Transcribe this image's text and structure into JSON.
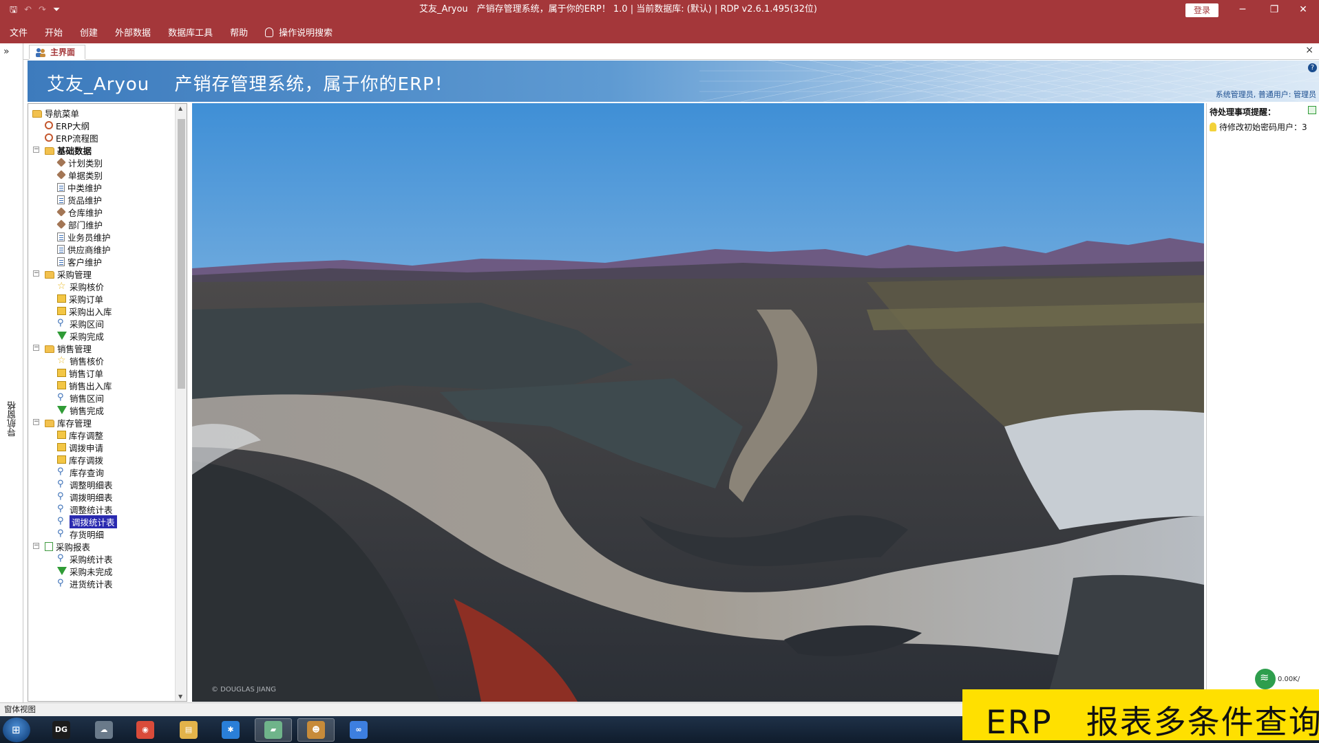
{
  "titlebar": {
    "title": "艾友_Aryou　产销存管理系统，属于你的ERP！ 1.0 | 当前数据库: (默认) | RDP v2.6.1.495(32位)",
    "login_label": "登录"
  },
  "menubar": {
    "items": [
      "文件",
      "开始",
      "创建",
      "外部数据",
      "数据库工具",
      "帮助"
    ],
    "search_label": "操作说明搜索"
  },
  "navpane": {
    "expand_glyph": "»",
    "vertical_label": "导航窗格"
  },
  "tabs": {
    "main_tab": "主界面",
    "close_glyph": "×"
  },
  "banner": {
    "brand": "艾友_Aryou",
    "title": "产销存管理系统，属于你的ERP！",
    "user_info": "系统管理员, 普通用户: 管理员",
    "help_glyph": "?"
  },
  "tree": {
    "nodes": [
      {
        "label": "导航菜单",
        "level": 0,
        "icon": "folder-open-icon",
        "toggle": ""
      },
      {
        "label": "ERP大纲",
        "level": 1,
        "icon": "gear-icon",
        "toggle": ""
      },
      {
        "label": "ERP流程图",
        "level": 1,
        "icon": "gear-icon",
        "toggle": ""
      },
      {
        "label": "基础数据",
        "level": 1,
        "icon": "folder-open-icon",
        "toggle": "−",
        "bold": true
      },
      {
        "label": "计划类别",
        "level": 2,
        "icon": "tag-icon"
      },
      {
        "label": "单据类别",
        "level": 2,
        "icon": "tag-icon"
      },
      {
        "label": "中类维护",
        "level": 2,
        "icon": "document-icon"
      },
      {
        "label": "货品维护",
        "level": 2,
        "icon": "document-icon"
      },
      {
        "label": "仓库维护",
        "level": 2,
        "icon": "tag-icon"
      },
      {
        "label": "部门维护",
        "level": 2,
        "icon": "tag-icon"
      },
      {
        "label": "业务员维护",
        "level": 2,
        "icon": "document-icon"
      },
      {
        "label": "供应商维护",
        "level": 2,
        "icon": "document-icon"
      },
      {
        "label": "客户维护",
        "level": 2,
        "icon": "document-icon"
      },
      {
        "label": "采购管理",
        "level": 1,
        "icon": "folder-open-icon",
        "toggle": "−"
      },
      {
        "label": "采购核价",
        "level": 2,
        "icon": "star-icon"
      },
      {
        "label": "采购订单",
        "level": 2,
        "icon": "box-icon"
      },
      {
        "label": "采购出入库",
        "level": 2,
        "icon": "box-icon"
      },
      {
        "label": "采购区间",
        "level": 2,
        "icon": "key-icon"
      },
      {
        "label": "采购完成",
        "level": 2,
        "icon": "funnel-icon"
      },
      {
        "label": "销售管理",
        "level": 1,
        "icon": "folder-open-icon",
        "toggle": "−"
      },
      {
        "label": "销售核价",
        "level": 2,
        "icon": "star-icon"
      },
      {
        "label": "销售订单",
        "level": 2,
        "icon": "box-icon"
      },
      {
        "label": "销售出入库",
        "level": 2,
        "icon": "box-icon"
      },
      {
        "label": "销售区间",
        "level": 2,
        "icon": "key-icon"
      },
      {
        "label": "销售完成",
        "level": 2,
        "icon": "funnel-icon"
      },
      {
        "label": "库存管理",
        "level": 1,
        "icon": "folder-open-icon",
        "toggle": "−"
      },
      {
        "label": "库存调整",
        "level": 2,
        "icon": "box-icon"
      },
      {
        "label": "调拨申请",
        "level": 2,
        "icon": "box-icon"
      },
      {
        "label": "库存调拨",
        "level": 2,
        "icon": "box-icon"
      },
      {
        "label": "库存查询",
        "level": 2,
        "icon": "key-icon"
      },
      {
        "label": "调整明细表",
        "level": 2,
        "icon": "key-icon"
      },
      {
        "label": "调拨明细表",
        "level": 2,
        "icon": "key-icon"
      },
      {
        "label": "调整统计表",
        "level": 2,
        "icon": "key-icon"
      },
      {
        "label": "调拨统计表",
        "level": 2,
        "icon": "key-icon",
        "selected": true
      },
      {
        "label": "存货明细",
        "level": 2,
        "icon": "key-icon"
      },
      {
        "label": "采购报表",
        "level": 1,
        "icon": "report-icon",
        "toggle": "−"
      },
      {
        "label": "采购统计表",
        "level": 2,
        "icon": "key-icon"
      },
      {
        "label": "采购未完成",
        "level": 2,
        "icon": "funnel-icon"
      },
      {
        "label": "进货统计表",
        "level": 2,
        "icon": "key-icon"
      }
    ]
  },
  "landscape": {
    "credit": "© DOUGLAS JIANG"
  },
  "reminders": {
    "heading": "待处理事项提醒：",
    "items": [
      "待修改初始密码用户：3"
    ],
    "net_speed": "0.00K/"
  },
  "statusbar": {
    "text": "窗体视图"
  },
  "taskbar": {
    "apps": [
      {
        "name": "datagrip-app",
        "glyph": "DG",
        "color": "#1c1c1c"
      },
      {
        "name": "sync-app",
        "glyph": "☁",
        "color": "#6a7a8a"
      },
      {
        "name": "chrome-app",
        "glyph": "◉",
        "color": "#d94b3a"
      },
      {
        "name": "explorer-app",
        "glyph": "▤",
        "color": "#e3b34a"
      },
      {
        "name": "star-app",
        "glyph": "✱",
        "color": "#2a7fd8"
      },
      {
        "name": "access-app",
        "glyph": "▰",
        "color": "#6fb48a"
      },
      {
        "name": "users-app",
        "glyph": "☻",
        "color": "#c78b3a"
      },
      {
        "name": "baidu-app",
        "glyph": "∞",
        "color": "#3d7fe0"
      }
    ]
  },
  "caption": {
    "text": "ERP　报表多条件查询"
  },
  "colors": {
    "brand": "#a4373a",
    "banner_blue": "#3d7bbd",
    "caption_yellow": "#ffe000",
    "tree_selected": "#2a2ab0"
  }
}
